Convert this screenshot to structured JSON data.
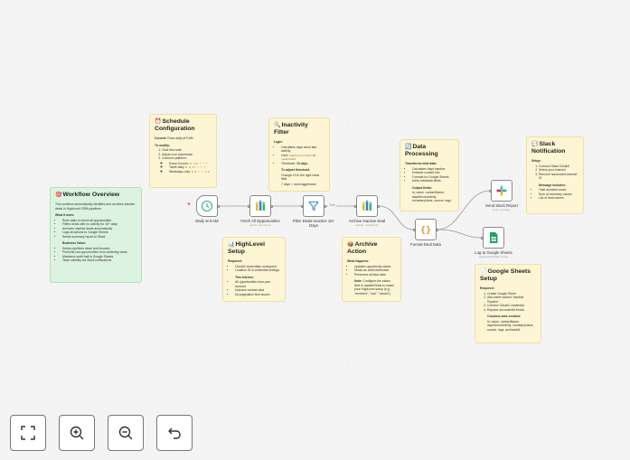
{
  "colors": {
    "note": "#fdf5d3",
    "note_green": "#dcf3e0",
    "wire": "#999999",
    "accent": "#e0504a"
  },
  "notes": {
    "overview": {
      "emoji": "🎯",
      "title": "Workflow Overview",
      "intro": "This workflow automatically identifies and archives inactive deals in HighLevel CRM pipelines.",
      "does_heading": "What it does:",
      "does": [
        "Runs daily to check all opportunities",
        "Filters deals with no activity for 10+ days",
        "Archives inactive deals automatically",
        "Logs all actions to Google Sheets",
        "Sends summary report to Slack"
      ],
      "value_heading": "Business Value:",
      "value": [
        "Keeps pipelines clean and focused",
        "Prevents lost opportunities from cluttering views",
        "Maintains audit trail in Google Sheets",
        "Team visibility via Slack notifications"
      ]
    },
    "schedule": {
      "emoji": "⏰",
      "title": "Schedule Configuration",
      "current_label": "Current:",
      "current_value": "Runs daily at 9 AM",
      "modify_heading": "To modify:",
      "steps": [
        "Click this node",
        "Adjust cron expression",
        "Common patterns:"
      ],
      "patterns": [
        {
          "label": "Every 6 hours:",
          "code": "0 */6 * * *"
        },
        {
          "label": "Twice daily:",
          "code": "0 9,17 * * *"
        },
        {
          "label": "Weekdays only:",
          "code": "0 9 * * 1-5"
        }
      ]
    },
    "inactivity": {
      "emoji": "🔍",
      "title": "Inactivity Filter",
      "logic_heading": "Logic:",
      "logic_1": "Calculates days since last activity",
      "uses_prefix": "Uses",
      "uses_code": "lastActivityAt",
      "uses_mid": "or",
      "uses_code2": "updatedAt",
      "threshold_prefix": "Threshold:",
      "threshold_value": "10 days",
      "adjust_heading": "To adjust threshold:",
      "adjust_1": "Change 10 in the right value field",
      "adjust_2": "7 days = more aggressive"
    },
    "processing": {
      "emoji": "🔄",
      "title": "Data Processing",
      "heading": "Transforms deal data:",
      "items": [
        "Calculates days inactive",
        "Extracts contact info",
        "Formats for Google Sheets",
        "Adds metadata fields"
      ],
      "output_heading": "Output fields:",
      "output_text": "id, name, contactName, daysSinceActivity, monetaryValue, source, tags"
    },
    "slack": {
      "emoji": "💬",
      "title": "Slack Notification",
      "setup_heading": "Setup:",
      "setup": [
        "Connect Slack OAuth2",
        "Select your channel",
        "Remove hardcoded channel ID"
      ],
      "msg_heading": "Message includes:",
      "msg": [
        "Total archived count",
        "Sum of monetary values",
        "List of deal names"
      ]
    },
    "highlevel": {
      "emoji": "📊",
      "title": "HighLevel Setup",
      "req_heading": "Required:",
      "req": [
        "OAuth2 credentials configured",
        "Location ID in credential settings"
      ],
      "fetch_heading": "This fetches:",
      "fetch": [
        "All opportunities from your account",
        "Includes contact data",
        "No pagination limit issues"
      ]
    },
    "archive": {
      "emoji": "📦",
      "title": "Archive Action",
      "what_heading": "What happens:",
      "what": [
        "Updates opportunity status",
        "Marks as archived/closed",
        "Preserves all deal data"
      ],
      "note_label": "Note:",
      "note_text": "Configure the status field in updateFields to match your HighLevel setup (e.g., \"archived\", \"lost\", \"closed\")"
    },
    "sheets": {
      "emoji": "📄",
      "title": "Google Sheets Setup",
      "req_heading": "Required:",
      "req": [
        "Create Google Sheet",
        "Add sheet named \"Inactive Pipeline\"",
        "Connect OAuth2 credential",
        "Replace documentId below"
      ],
      "cols_heading": "Columns auto-created:",
      "cols_text": "id, name, contactName, daysSinceActivity, monetaryValue, source, tags, archivedAt"
    }
  },
  "nodes": {
    "trigger": {
      "label": "Daily at 9 AM",
      "icon": "clock-icon"
    },
    "fetch": {
      "label": "Fetch All Opportunities",
      "sub": "getAll: opportunity",
      "icon": "highlevel-icon"
    },
    "filter": {
      "label": "Filter Deals Inactive 10+ Days",
      "icon": "filter-icon"
    },
    "archive": {
      "label": "Archive Inactive Deal",
      "sub": "update: opportunity",
      "icon": "highlevel-icon"
    },
    "format": {
      "label": "Format Deal Data",
      "icon": "code-braces-icon"
    },
    "slack": {
      "label": "Send Slack Report",
      "sub": "post: message",
      "icon": "slack-icon"
    },
    "sheets": {
      "label": "Log to Google Sheets",
      "sub": "appendOrUpdate: sheet",
      "icon": "google-sheets-icon"
    }
  },
  "wire_labels": {
    "filter_true": "True"
  },
  "controls": [
    {
      "name": "fit-view-button",
      "icon": "fit-view-icon"
    },
    {
      "name": "zoom-in-button",
      "icon": "zoom-in-icon"
    },
    {
      "name": "zoom-out-button",
      "icon": "zoom-out-icon"
    },
    {
      "name": "undo-button",
      "icon": "undo-icon"
    }
  ]
}
